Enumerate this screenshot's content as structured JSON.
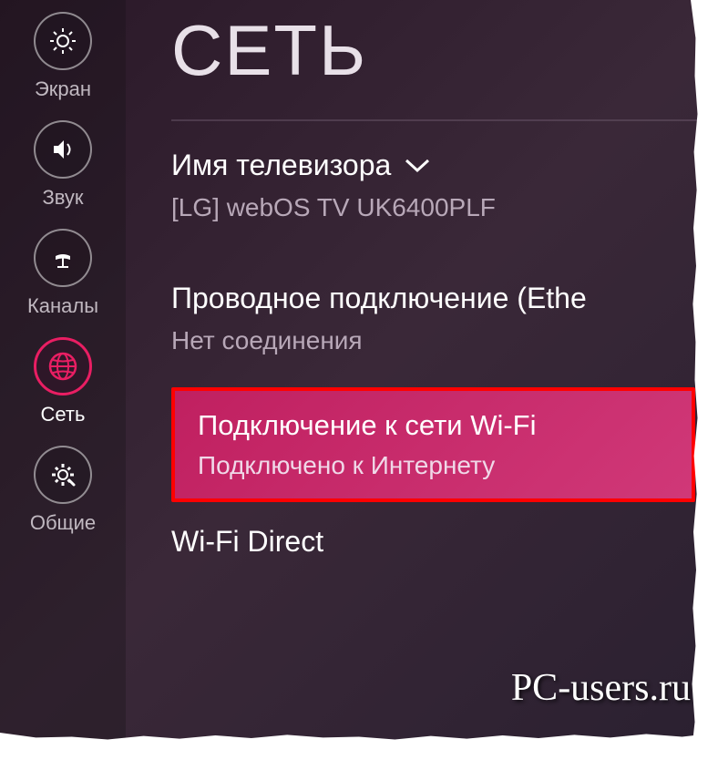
{
  "page_title": "СЕТЬ",
  "sidebar": {
    "items": [
      {
        "label": "Экран",
        "icon": "display-icon"
      },
      {
        "label": "Звук",
        "icon": "speaker-icon"
      },
      {
        "label": "Каналы",
        "icon": "satellite-icon"
      },
      {
        "label": "Сеть",
        "icon": "globe-icon",
        "active": true
      },
      {
        "label": "Общие",
        "icon": "gear-icon"
      }
    ]
  },
  "sections": {
    "tv_name": {
      "title": "Имя телевизора",
      "value": "[LG] webOS TV UK6400PLF"
    },
    "wired": {
      "title": "Проводное подключение (Ethe",
      "value": "Нет соединения"
    },
    "wifi": {
      "title": "Подключение к сети Wi-Fi",
      "value": "Подключено к Интернету"
    },
    "wifi_direct": {
      "title": "Wi-Fi Direct"
    }
  },
  "watermark": "PC-users.ru"
}
